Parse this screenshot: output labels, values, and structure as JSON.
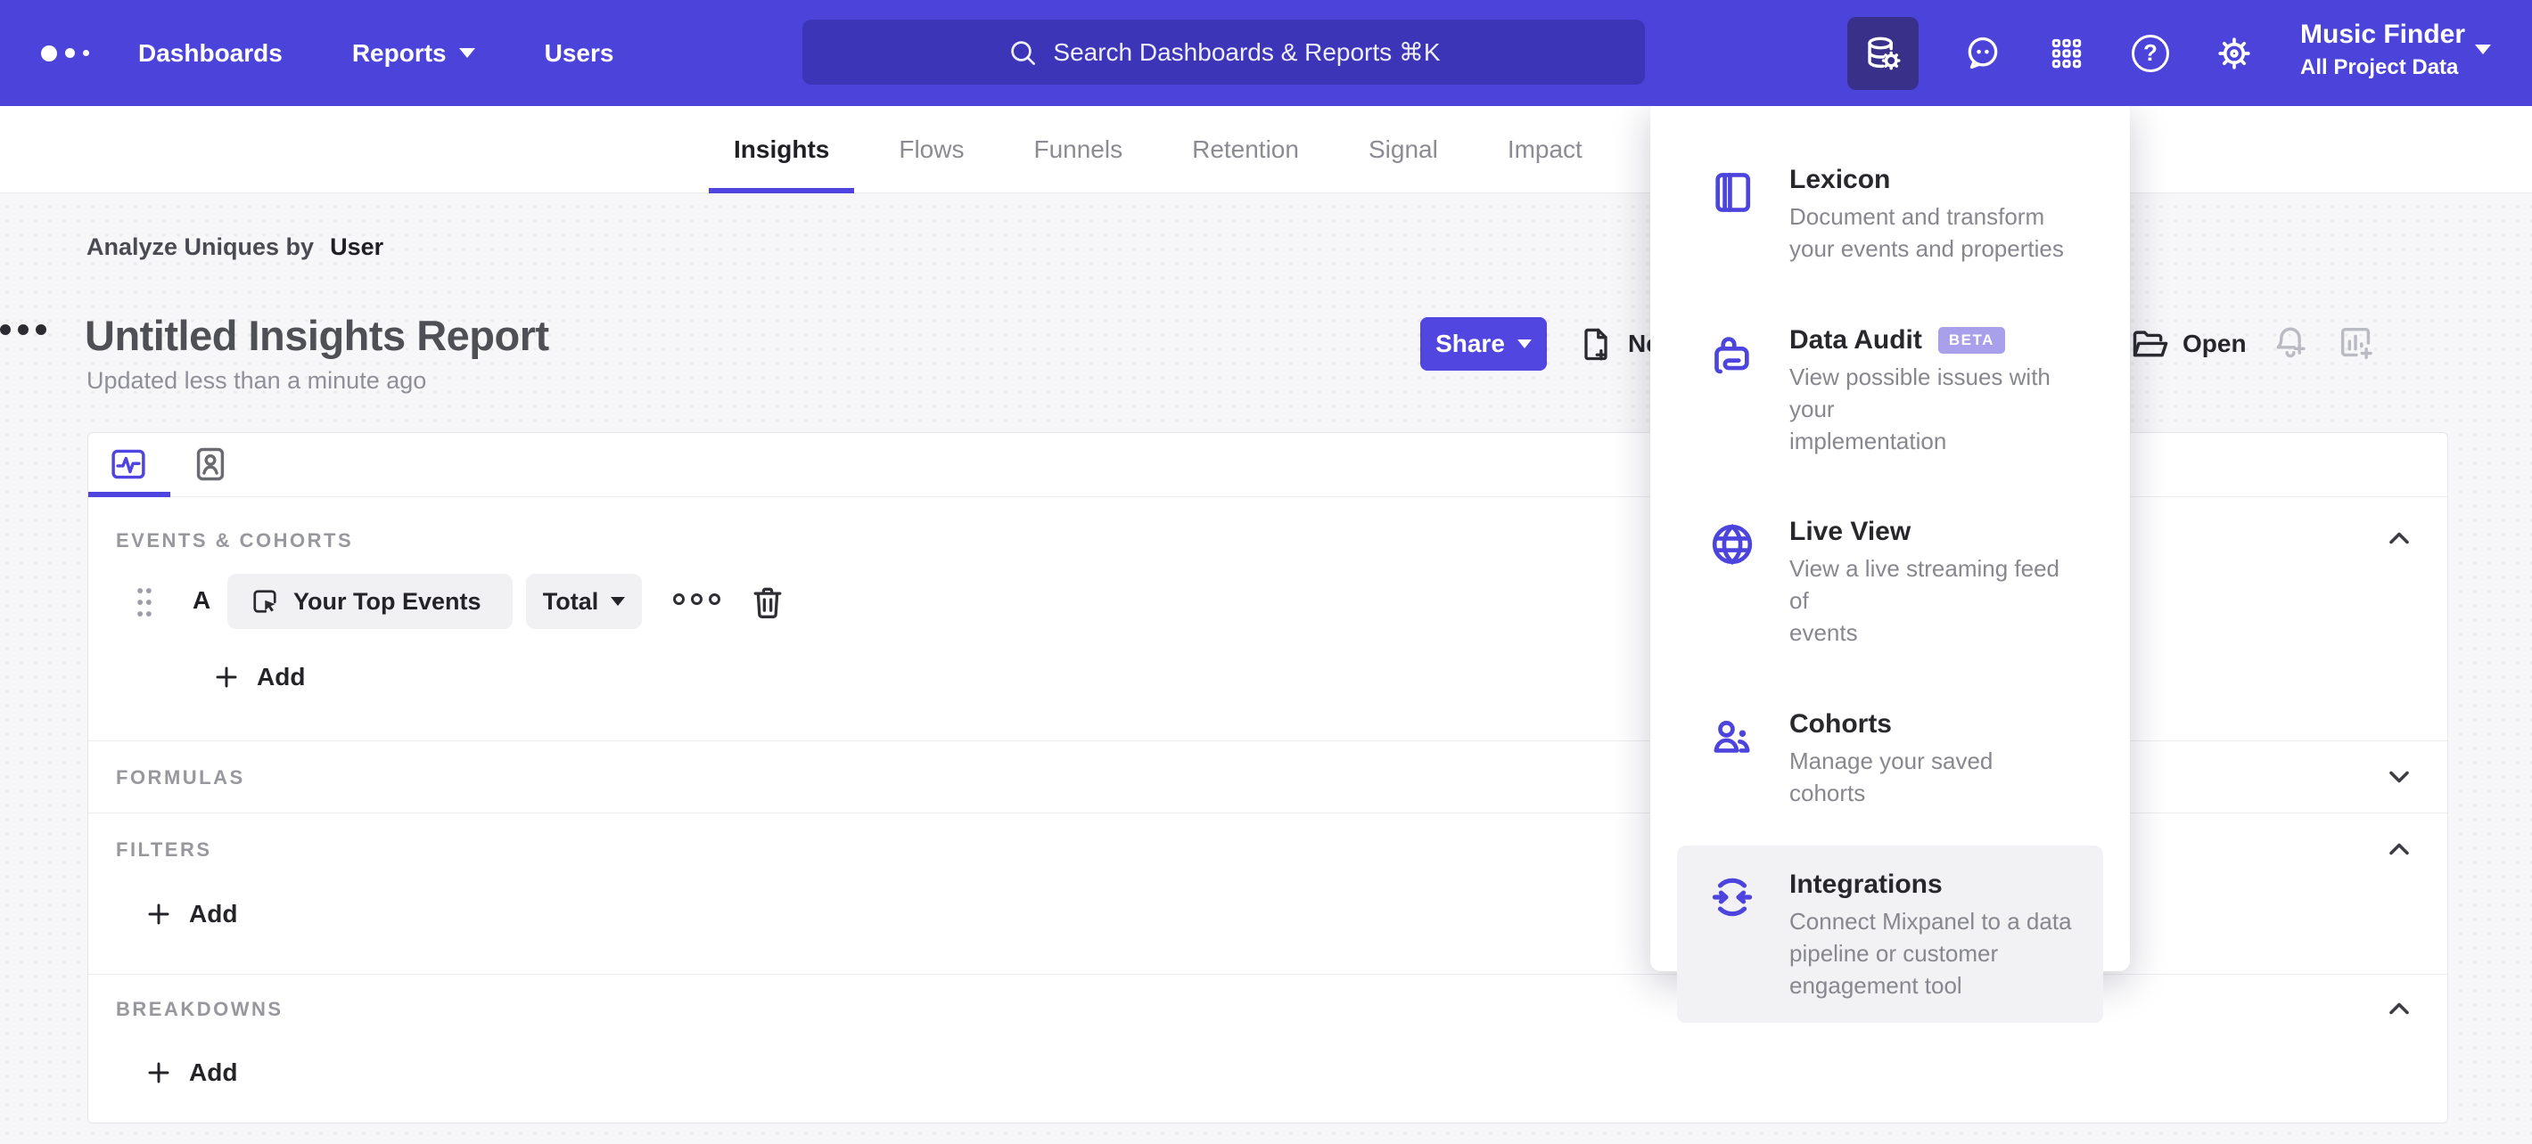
{
  "topnav": {
    "links": [
      {
        "label": "Dashboards",
        "caret": false
      },
      {
        "label": "Reports",
        "caret": true
      },
      {
        "label": "Users",
        "caret": false
      }
    ],
    "search_placeholder": "Search Dashboards & Reports ⌘K",
    "project": {
      "name": "Music Finder",
      "scope": "All Project Data"
    }
  },
  "tabs": {
    "active": "Insights",
    "items": [
      {
        "label": "Insights"
      },
      {
        "label": "Flows"
      },
      {
        "label": "Funnels"
      },
      {
        "label": "Retention"
      },
      {
        "label": "Signal"
      },
      {
        "label": "Impact"
      }
    ]
  },
  "report": {
    "analyze_label": "Analyze Uniques by",
    "analyze_value": "User",
    "title": "Untitled Insights Report",
    "updated": "Updated less than a minute ago",
    "share_label": "Share",
    "new_label": "New",
    "open_label": "Open"
  },
  "builder": {
    "events_header": "EVENTS & COHORTS",
    "row": {
      "letter": "A",
      "event": "Your Top Events",
      "metric": "Total"
    },
    "add_label": "Add",
    "formulas_header": "FORMULAS",
    "filters_header": "FILTERS",
    "breakdowns_header": "BREAKDOWNS"
  },
  "menu": {
    "items": [
      {
        "title": "Lexicon",
        "badge": "",
        "desc": "Document and transform\nyour events and properties"
      },
      {
        "title": "Data Audit",
        "badge": "BETA",
        "desc": "View possible issues with your\nimplementation"
      },
      {
        "title": "Live View",
        "badge": "",
        "desc": "View a live streaming feed of\nevents"
      },
      {
        "title": "Cohorts",
        "badge": "",
        "desc": "Manage your saved cohorts"
      },
      {
        "title": "Integrations",
        "badge": "",
        "desc": "Connect Mixpanel to a data\npipeline or customer\nengagement tool"
      }
    ]
  },
  "colors": {
    "nav_bg": "#4b43da",
    "nav_active_tile": "#393089",
    "accent": "#4f44e0",
    "badge_bg": "#a9a0ec",
    "page_bg": "#f7f7f9",
    "muted_text": "#8f8f99",
    "section_header": "#97979e"
  }
}
